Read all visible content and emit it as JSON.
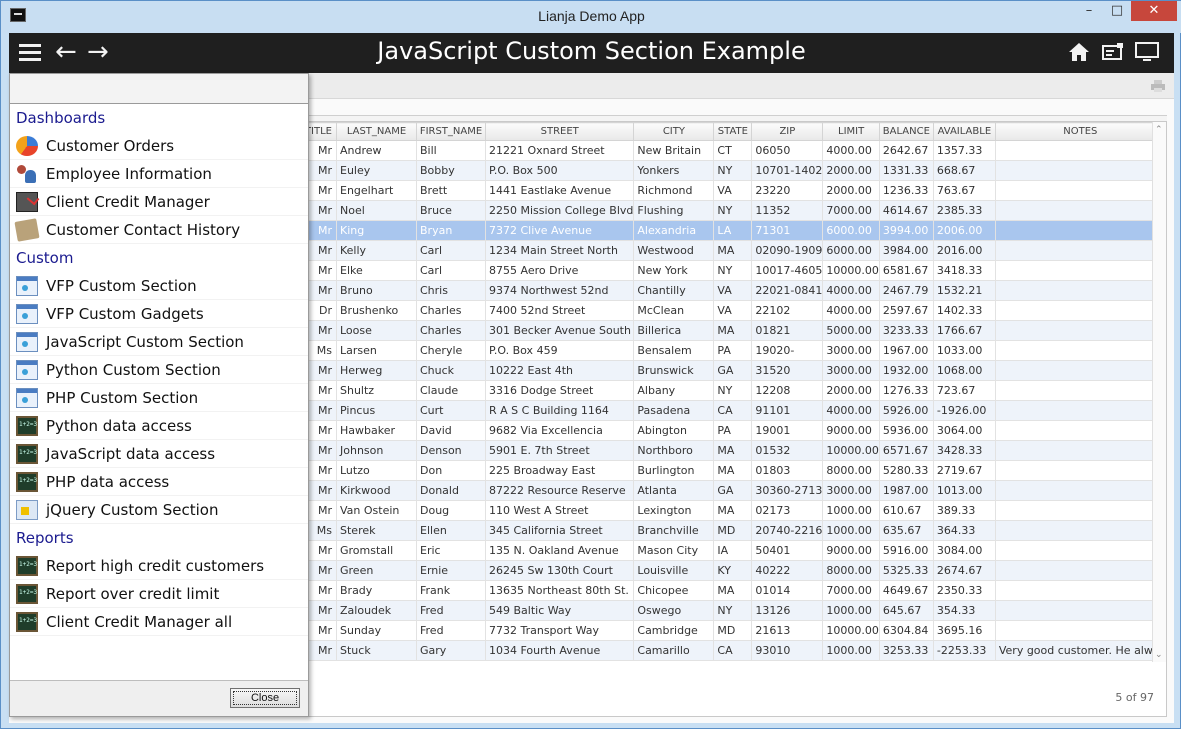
{
  "window": {
    "title": "Lianja Demo App",
    "min": "–",
    "max": "□",
    "close": "✕"
  },
  "header": {
    "title": "JavaScript Custom Section Example",
    "back": "←",
    "forward": "→"
  },
  "grid": {
    "columns": [
      "TITLE",
      "LAST_NAME",
      "FIRST_NAME",
      "STREET",
      "CITY",
      "STATE",
      "ZIP",
      "LIMIT",
      "BALANCE",
      "AVAILABLE",
      "NOTES"
    ],
    "rows": [
      [
        "Mr",
        "Andrew",
        "Bill",
        "21221 Oxnard Street",
        "New Britain",
        "CT",
        "06050",
        "4000.00",
        "2642.67",
        "1357.33",
        ""
      ],
      [
        "Mr",
        "Euley",
        "Bobby",
        "P.O. Box 500",
        "Yonkers",
        "NY",
        "10701-1402",
        "2000.00",
        "1331.33",
        "668.67",
        ""
      ],
      [
        "Mr",
        "Engelhart",
        "Brett",
        "1441 Eastlake Avenue",
        "Richmond",
        "VA",
        "23220",
        "2000.00",
        "1236.33",
        "763.67",
        ""
      ],
      [
        "Mr",
        "Noel",
        "Bruce",
        "2250 Mission College Blvd",
        "Flushing",
        "NY",
        "11352",
        "7000.00",
        "4614.67",
        "2385.33",
        ""
      ],
      [
        "Mr",
        "King",
        "Bryan",
        "7372 Clive Avenue",
        "Alexandria",
        "LA",
        "71301",
        "6000.00",
        "3994.00",
        "2006.00",
        ""
      ],
      [
        "Mr",
        "Kelly",
        "Carl",
        "1234 Main Street North",
        "Westwood",
        "MA",
        "02090-1909",
        "6000.00",
        "3984.00",
        "2016.00",
        ""
      ],
      [
        "Mr",
        "Elke",
        "Carl",
        "8755 Aero Drive",
        "New York",
        "NY",
        "10017-4605",
        "10000.00",
        "6581.67",
        "3418.33",
        ""
      ],
      [
        "Mr",
        "Bruno",
        "Chris",
        "9374 Northwest 52nd",
        "Chantilly",
        "VA",
        "22021-0841",
        "4000.00",
        "2467.79",
        "1532.21",
        ""
      ],
      [
        "Dr",
        "Brushenko",
        "Charles",
        "7400 52nd Street",
        "McClean",
        "VA",
        "22102",
        "4000.00",
        "2597.67",
        "1402.33",
        ""
      ],
      [
        "Mr",
        "Loose",
        "Charles",
        "301 Becker Avenue South",
        "Billerica",
        "MA",
        "01821",
        "5000.00",
        "3233.33",
        "1766.67",
        ""
      ],
      [
        "Ms",
        "Larsen",
        "Cheryle",
        "P.O. Box 459",
        "Bensalem",
        "PA",
        "19020-",
        "3000.00",
        "1967.00",
        "1033.00",
        ""
      ],
      [
        "Mr",
        "Herweg",
        "Chuck",
        "10222 East 4th",
        "Brunswick",
        "GA",
        "31520",
        "3000.00",
        "1932.00",
        "1068.00",
        ""
      ],
      [
        "Mr",
        "Shultz",
        "Claude",
        "3316 Dodge Street",
        "Albany",
        "NY",
        "12208",
        "2000.00",
        "1276.33",
        "723.67",
        ""
      ],
      [
        "Mr",
        "Pincus",
        "Curt",
        "R A S C Building 1164",
        "Pasadena",
        "CA",
        "91101",
        "4000.00",
        "5926.00",
        "-1926.00",
        ""
      ],
      [
        "Mr",
        "Hawbaker",
        "David",
        "9682 Via Excellencia",
        "Abington",
        "PA",
        "19001",
        "9000.00",
        "5936.00",
        "3064.00",
        ""
      ],
      [
        "Mr",
        "Johnson",
        "Denson",
        "5901 E. 7th Street",
        "Northboro",
        "MA",
        "01532",
        "10000.00",
        "6571.67",
        "3428.33",
        ""
      ],
      [
        "Mr",
        "Lutzo",
        "Don",
        "225 Broadway East",
        "Burlington",
        "MA",
        "01803",
        "8000.00",
        "5280.33",
        "2719.67",
        ""
      ],
      [
        "Mr",
        "Kirkwood",
        "Donald",
        "87222 Resource Reserve",
        "Atlanta",
        "GA",
        "30360-2713",
        "3000.00",
        "1987.00",
        "1013.00",
        ""
      ],
      [
        "Mr",
        "Van Ostein",
        "Doug",
        "110 West A Street",
        "Lexington",
        "MA",
        "02173",
        "1000.00",
        "610.67",
        "389.33",
        ""
      ],
      [
        "Ms",
        "Sterek",
        "Ellen",
        "345 California Street",
        "Branchville",
        "MD",
        "20740-2216",
        "1000.00",
        "635.67",
        "364.33",
        ""
      ],
      [
        "Mr",
        "Gromstall",
        "Eric",
        "135 N. Oakland Avenue",
        "Mason City",
        "IA",
        "50401",
        "9000.00",
        "5916.00",
        "3084.00",
        ""
      ],
      [
        "Mr",
        "Green",
        "Ernie",
        "26245 Sw 130th Court",
        "Louisville",
        "KY",
        "40222",
        "8000.00",
        "5325.33",
        "2674.67",
        ""
      ],
      [
        "Mr",
        "Brady",
        "Frank",
        "13635 Northeast 80th St.",
        "Chicopee",
        "MA",
        "01014",
        "7000.00",
        "4649.67",
        "2350.33",
        ""
      ],
      [
        "Mr",
        "Zaloudek",
        "Fred",
        "549 Baltic Way",
        "Oswego",
        "NY",
        "13126",
        "1000.00",
        "645.67",
        "354.33",
        ""
      ],
      [
        "Mr",
        "Sunday",
        "Fred",
        "7732 Transport Way",
        "Cambridge",
        "MD",
        "21613",
        "10000.00",
        "6304.84",
        "3695.16",
        ""
      ],
      [
        "Mr",
        "Stuck",
        "Gary",
        "1034 Fourth Avenue",
        "Camarillo",
        "CA",
        "93010",
        "1000.00",
        "3253.33",
        "-2253.33",
        "Very good customer. He alw..."
      ]
    ],
    "pager": "5 of 97"
  },
  "sidebar": {
    "groups": [
      {
        "label": "Dashboards",
        "items": [
          {
            "label": "Customer Orders",
            "icon": "pie-chart-icon"
          },
          {
            "label": "Employee Information",
            "icon": "people-icon"
          },
          {
            "label": "Client Credit Manager",
            "icon": "calculator-icon"
          },
          {
            "label": "Customer Contact History",
            "icon": "contact-cards-icon"
          }
        ]
      },
      {
        "label": "Custom",
        "items": [
          {
            "label": "VFP Custom Section",
            "icon": "window-icon"
          },
          {
            "label": "VFP Custom Gadgets",
            "icon": "window-icon"
          },
          {
            "label": "JavaScript Custom Section",
            "icon": "window-icon"
          },
          {
            "label": "Python Custom Section",
            "icon": "window-icon"
          },
          {
            "label": "PHP Custom Section",
            "icon": "window-icon"
          },
          {
            "label": "Python data access",
            "icon": "chalkboard-icon"
          },
          {
            "label": "JavaScript data access",
            "icon": "chalkboard-icon"
          },
          {
            "label": "PHP data access",
            "icon": "chalkboard-icon"
          },
          {
            "label": "jQuery Custom Section",
            "icon": "jquery-icon"
          }
        ]
      },
      {
        "label": "Reports",
        "items": [
          {
            "label": "Report high credit customers",
            "icon": "chalkboard-icon"
          },
          {
            "label": "Report over credit limit",
            "icon": "chalkboard-icon"
          },
          {
            "label": "Client Credit Manager all",
            "icon": "chalkboard-icon"
          }
        ]
      }
    ],
    "close_label": "Close"
  }
}
